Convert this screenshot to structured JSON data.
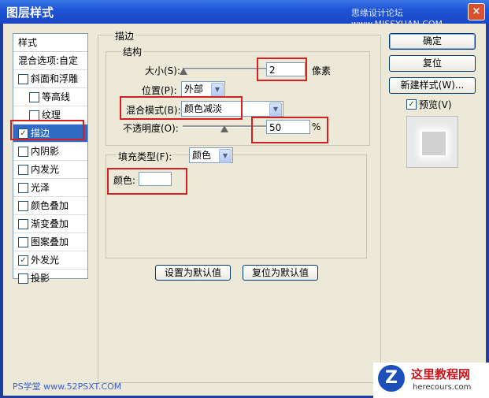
{
  "window": {
    "title": "图层样式",
    "watermark": "思缘设计论坛 www.MISSYUAN.COM",
    "close_glyph": "×"
  },
  "styles_panel": {
    "header": "样式",
    "blend_options": "混合选项:自定",
    "items": [
      {
        "label": "斜面和浮雕",
        "checked": false,
        "check": ""
      },
      {
        "label": "等高线",
        "checked": false,
        "check": ""
      },
      {
        "label": "纹理",
        "checked": false,
        "check": ""
      },
      {
        "label": "描边",
        "checked": true,
        "check": "✓"
      },
      {
        "label": "内阴影",
        "checked": false,
        "check": ""
      },
      {
        "label": "内发光",
        "checked": false,
        "check": ""
      },
      {
        "label": "光泽",
        "checked": false,
        "check": ""
      },
      {
        "label": "颜色叠加",
        "checked": false,
        "check": ""
      },
      {
        "label": "渐变叠加",
        "checked": false,
        "check": ""
      },
      {
        "label": "图案叠加",
        "checked": false,
        "check": ""
      },
      {
        "label": "外发光",
        "checked": true,
        "check": "✓"
      },
      {
        "label": "投影",
        "checked": false,
        "check": ""
      }
    ]
  },
  "stroke": {
    "group_title": "描边",
    "structure_title": "结构",
    "size_label": "大小(S):",
    "size_value": "2",
    "size_unit": "像素",
    "size_slider": 0.01,
    "position_label": "位置(P):",
    "position_value": "外部",
    "blend_label": "混合模式(B):",
    "blend_value": "颜色减淡",
    "opacity_label": "不透明度(O):",
    "opacity_value": "50",
    "opacity_unit": "%",
    "opacity_slider": 0.5,
    "fill_type_label": "填充类型(F):",
    "fill_type_value": "颜色",
    "color_label": "颜色:",
    "color_value": "#ffffff",
    "make_default": "设置为默认值",
    "reset_default": "复位为默认值"
  },
  "buttons": {
    "ok": "确定",
    "reset": "复位",
    "new_style": "新建样式(W)...",
    "preview_label": "预览(V)",
    "preview_check": "✓"
  },
  "icons": {
    "dropdown": "▼"
  },
  "watermarks": {
    "bottom_left": "PS学堂 www.52PSXT.COM",
    "logo_mark": "Z",
    "logo_title": "这里教程网",
    "logo_url": "herecours.com"
  }
}
